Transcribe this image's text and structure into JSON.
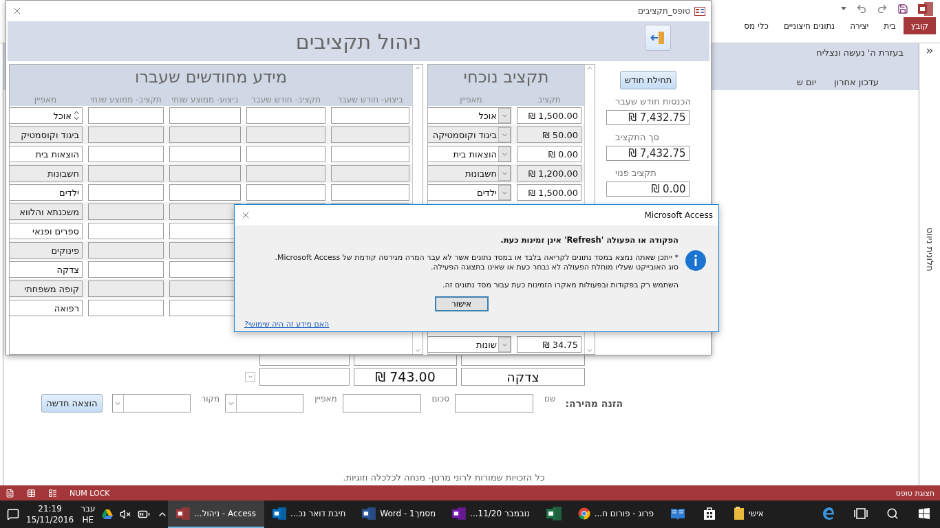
{
  "app": {
    "ribbon_tabs": [
      {
        "label": "קובץ",
        "selected": true
      },
      {
        "label": "בית",
        "selected": false
      },
      {
        "label": "יצירה",
        "selected": false
      },
      {
        "label": "נתונים חיצוניים",
        "selected": false
      },
      {
        "label": "כלי מס",
        "selected": false
      }
    ],
    "nav_pane": "חלונית ניווט",
    "status_bar": {
      "num_lock": "NUM LOCK",
      "view": "תצוגת טופס"
    }
  },
  "main_form": {
    "banner": "בעזרת ה' נעשה ונצליח",
    "tabs": [
      "עדכון אחרון",
      "יום ש"
    ],
    "bottom_rows": [
      {
        "category": "צדקה",
        "amount": "743.00 ₪"
      }
    ],
    "quick_entry": {
      "title": "הזנה מהירה:",
      "fields": [
        {
          "kind": "text",
          "label": "שם"
        },
        {
          "kind": "text",
          "label": "סכום"
        },
        {
          "kind": "select",
          "label": "מאפיין"
        },
        {
          "kind": "select",
          "label": "מקור"
        }
      ],
      "button": "הוצאה חדשה"
    },
    "footer": "כל הזכויות שמורות לרוני מרטן- מנחה לכלכלה וזוגיות."
  },
  "form_window": {
    "title": "טופס_תקציבים",
    "heading": "ניהול תקציבים",
    "start_button": "תחילת חודש",
    "summary": [
      {
        "label": "הכנסות חודש שעבר",
        "value": "7,432.75 ₪"
      },
      {
        "label": "סך התקציב",
        "value": "7,432.75 ₪"
      },
      {
        "label": "תקציב פנוי",
        "value": "0.00 ₪"
      }
    ],
    "current_budget": {
      "title": "תקציב נוכחי",
      "columns": [
        "תקציב",
        "מאפיין"
      ],
      "rows": [
        {
          "amount": "1,500.00 ₪",
          "category": "אוכל"
        },
        {
          "amount": "50.00 ₪",
          "category": "ביגוד וקוסמטיקה"
        },
        {
          "amount": "0.00 ₪",
          "category": "הוצאות בית"
        },
        {
          "amount": "1,200.00 ₪",
          "category": "חשבונות"
        },
        {
          "amount": "1,500.00 ₪",
          "category": "ילדים"
        }
      ],
      "last_row": {
        "amount": "34.75 ₪",
        "category": "שונות"
      }
    },
    "history": {
      "title": "מידע מחודשים שעברו",
      "columns": [
        "ביצוע- חודש שעבר",
        "תקציב- חודש שעבר",
        "ביצוע- ממוצע שנתי",
        "תקציב- ממוצע שנתי",
        "מאפיין"
      ],
      "rows": [
        "אוכל",
        "ביגוד וקוסמטיק",
        "הוצאות בית",
        "חשבונות",
        "ילדים",
        "משכנתא והלווא",
        "ספרים ופנאי",
        "פינוקים",
        "צדקה",
        "קופה משפחתי",
        "רפואה"
      ]
    }
  },
  "dialog": {
    "title": "Microsoft Access",
    "heading": "הפקודה או הפעולה 'Refresh' אינן זמינות כעת.",
    "lines": [
      "* ייתכן שאתה נמצא במסד נתונים לקריאה בלבד או במסד נתונים אשר לא עבר המרה מגירסה קודמת של Microsoft Access.",
      "סוג האובייקט שעליו מוחלת הפעולה לא נבחר כעת או שאינו בתצוגה הפעילה.",
      "השתמש רק בפקודות ובפעולות מאקרו הזמינות כעת עבור מסד נתונים זה."
    ],
    "button": "אישור",
    "link": "האם מידע זה היה שימושי?"
  },
  "taskbar": {
    "apps": [
      {
        "kind": "start",
        "active": false
      },
      {
        "kind": "search",
        "active": false
      },
      {
        "kind": "taskview",
        "active": false
      },
      {
        "kind": "edge",
        "active": false
      },
      {
        "kind": "folder",
        "label": "אישי",
        "active": false
      },
      {
        "kind": "store",
        "active": false
      },
      {
        "kind": "reader",
        "active": false
      },
      {
        "kind": "chrome",
        "label": "פרוג - פורום ח...",
        "active": false
      },
      {
        "kind": "excel",
        "active": false
      },
      {
        "kind": "onenote",
        "label": "נובמבר 11/20...",
        "active": false
      },
      {
        "kind": "word",
        "label": "מסמך1 - Word",
        "active": false
      },
      {
        "kind": "outlook",
        "label": "תיבת דואר נכ...",
        "active": false
      },
      {
        "kind": "access",
        "label": "Access - ניהול...",
        "active": true
      }
    ],
    "language": "עבר",
    "language_code": "HE",
    "time": "21:19",
    "date": "15/11/2016"
  }
}
